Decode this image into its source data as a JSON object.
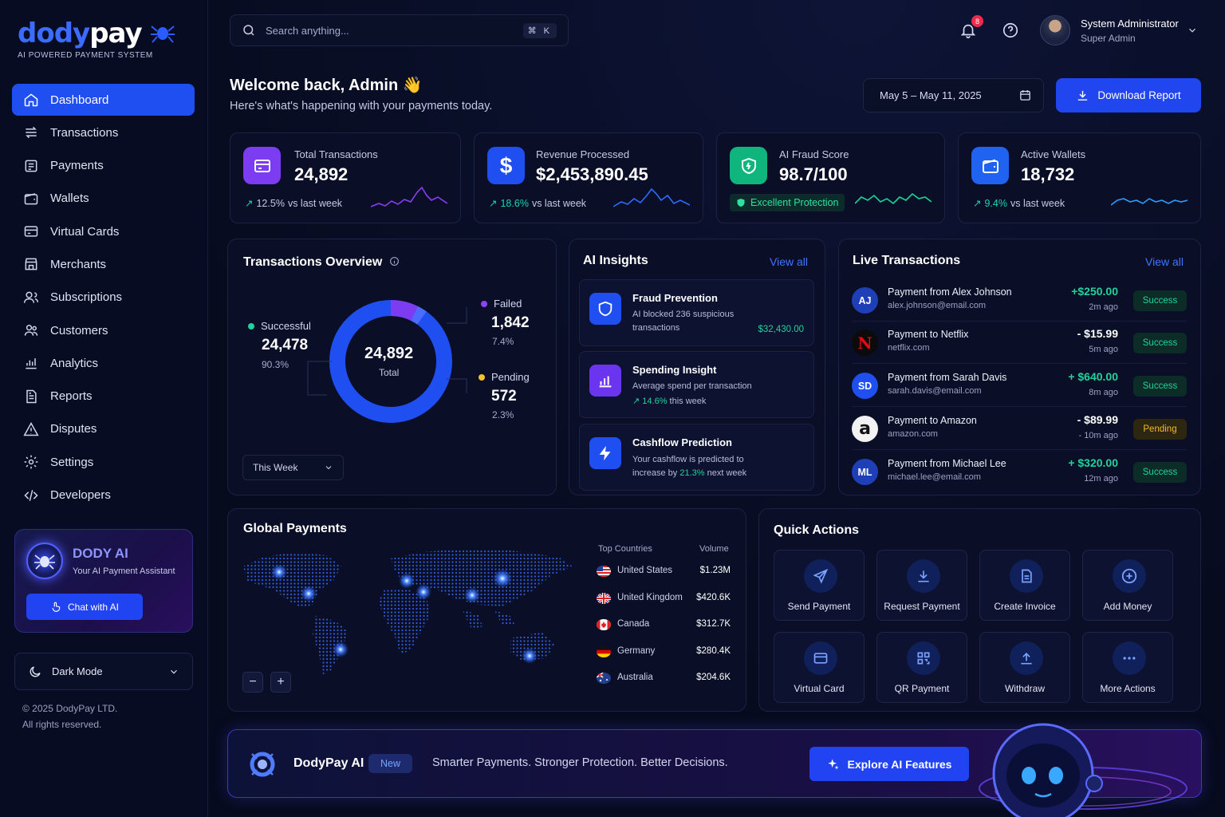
{
  "brand": {
    "name_a": "dodypay",
    "tagline": "AI POWERED PAYMENT SYSTEM"
  },
  "nav": [
    {
      "label": "Dashboard",
      "icon": "home-icon",
      "active": true
    },
    {
      "label": "Transactions",
      "icon": "transactions-icon"
    },
    {
      "label": "Payments",
      "icon": "payments-icon"
    },
    {
      "label": "Wallets",
      "icon": "wallet-icon"
    },
    {
      "label": "Virtual Cards",
      "icon": "card-icon"
    },
    {
      "label": "Merchants",
      "icon": "store-icon"
    },
    {
      "label": "Subscriptions",
      "icon": "users-icon"
    },
    {
      "label": "Customers",
      "icon": "customers-icon"
    },
    {
      "label": "Analytics",
      "icon": "analytics-icon"
    },
    {
      "label": "Reports",
      "icon": "report-icon"
    },
    {
      "label": "Disputes",
      "icon": "warning-icon"
    },
    {
      "label": "Settings",
      "icon": "gear-icon"
    },
    {
      "label": "Developers",
      "icon": "code-icon"
    }
  ],
  "ai_card": {
    "title": "DODY AI",
    "subtitle": "Your AI Payment Assistant",
    "button": "Chat with AI"
  },
  "dark_mode": {
    "label": "Dark Mode"
  },
  "footer": {
    "line1": "© 2025 DodyPay LTD.",
    "line2": "All rights reserved."
  },
  "search": {
    "placeholder": "Search anything...",
    "shortcut": "⌘ K"
  },
  "header": {
    "notifications": "8",
    "user_name": "System Administrator",
    "user_role": "Super Admin"
  },
  "welcome": {
    "title": "Welcome back, Admin 👋",
    "subtitle": "Here's what's happening with your payments today."
  },
  "date_range": "May 5 – May 11, 2025",
  "download_label": "Download Report",
  "stats": [
    {
      "label": "Total Transactions",
      "value": "24,892",
      "change": "12.5%",
      "suffix": "vs last week",
      "color": "#7b3cf2"
    },
    {
      "label": "Revenue Processed",
      "value": "$2,453,890.45",
      "change": "18.6%",
      "suffix": "vs last week",
      "color": "#1f4ff0"
    },
    {
      "label": "AI Fraud Score",
      "value": "98.7/100",
      "badge": "Excellent Protection",
      "color": "#0fb57d"
    },
    {
      "label": "Active Wallets",
      "value": "18,732",
      "change": "9.4%",
      "suffix": "vs last week",
      "color": "#1f63f0"
    }
  ],
  "overview": {
    "title": "Transactions Overview",
    "total": "24,892",
    "total_label": "Total",
    "successful": {
      "label": "Successful",
      "value": "24,478",
      "pct": "90.3%"
    },
    "failed": {
      "label": "Failed",
      "value": "1,842",
      "pct": "7.4%"
    },
    "pending": {
      "label": "Pending",
      "value": "572",
      "pct": "2.3%"
    },
    "period": "This Week"
  },
  "insights": {
    "title": "AI Insights",
    "view_all": "View all",
    "items": [
      {
        "title": "Fraud Prevention",
        "line1": "AI blocked 236 suspicious",
        "line2": "transactions",
        "amount": "$32,430.00"
      },
      {
        "title": "Spending Insight",
        "line1": "Average spend per transaction",
        "pct": "14.6%",
        "pct_suffix": "this week"
      },
      {
        "title": "Cashflow Prediction",
        "line1": "Your cashflow is predicted to",
        "line2a": "increase by",
        "pct": "21.3%",
        "line2b": "next week"
      }
    ]
  },
  "live": {
    "title": "Live Transactions",
    "view_all": "View all",
    "rows": [
      {
        "initials": "AJ",
        "name": "Payment from Alex Johnson",
        "email": "alex.johnson@email.com",
        "amount": "+$250.00",
        "time": "2m ago",
        "status": "Success",
        "avatar_color": "#1f3fb8",
        "amount_color": "#22d39b"
      },
      {
        "initials": "N",
        "name": "Payment to Netflix",
        "email": "netflix.com",
        "amount": "- $15.99",
        "time": "5m ago",
        "status": "Success",
        "avatar_color": "#111111",
        "amount_color": "#ffffff"
      },
      {
        "initials": "SD",
        "name": "Payment from Sarah Davis",
        "email": "sarah.davis@email.com",
        "amount": "+ $640.00",
        "time": "8m ago",
        "status": "Success",
        "avatar_color": "#1f4ff0",
        "amount_color": "#22d39b"
      },
      {
        "initials": "a",
        "name": "Payment to Amazon",
        "email": "amazon.com",
        "amount": "- $89.99",
        "time": "- 10m ago",
        "status": "Pending",
        "avatar_color": "#f2f2f2",
        "amount_color": "#ffffff"
      },
      {
        "initials": "ML",
        "name": "Payment from Michael Lee",
        "email": "michael.lee@email.com",
        "amount": "+ $320.00",
        "time": "12m ago",
        "status": "Success",
        "avatar_color": "#1f3fb8",
        "amount_color": "#22d39b"
      }
    ]
  },
  "global": {
    "title": "Global Payments",
    "col_countries": "Top Countries",
    "col_volume": "Volume",
    "countries": [
      {
        "name": "United States",
        "volume": "$1.23M"
      },
      {
        "name": "United Kingdom",
        "volume": "$420.6K"
      },
      {
        "name": "Canada",
        "volume": "$312.7K"
      },
      {
        "name": "Germany",
        "volume": "$280.4K"
      },
      {
        "name": "Australia",
        "volume": "$204.6K"
      }
    ],
    "zoom_out": "−",
    "zoom_in": "+"
  },
  "quick": {
    "title": "Quick Actions",
    "items": [
      {
        "label": "Send Payment",
        "icon": "send-icon"
      },
      {
        "label": "Request Payment",
        "icon": "download-icon"
      },
      {
        "label": "Create Invoice",
        "icon": "invoice-icon"
      },
      {
        "label": "Add Money",
        "icon": "plus-circle-icon"
      },
      {
        "label": "Virtual Card",
        "icon": "card-icon"
      },
      {
        "label": "QR Payment",
        "icon": "qr-icon"
      },
      {
        "label": "Withdraw",
        "icon": "upload-icon"
      },
      {
        "label": "More Actions",
        "icon": "more-icon"
      }
    ]
  },
  "banner": {
    "name": "DodyPay AI",
    "badge": "New",
    "tagline": "Smarter Payments. Stronger Protection. Better Decisions.",
    "button": "Explore AI Features"
  }
}
